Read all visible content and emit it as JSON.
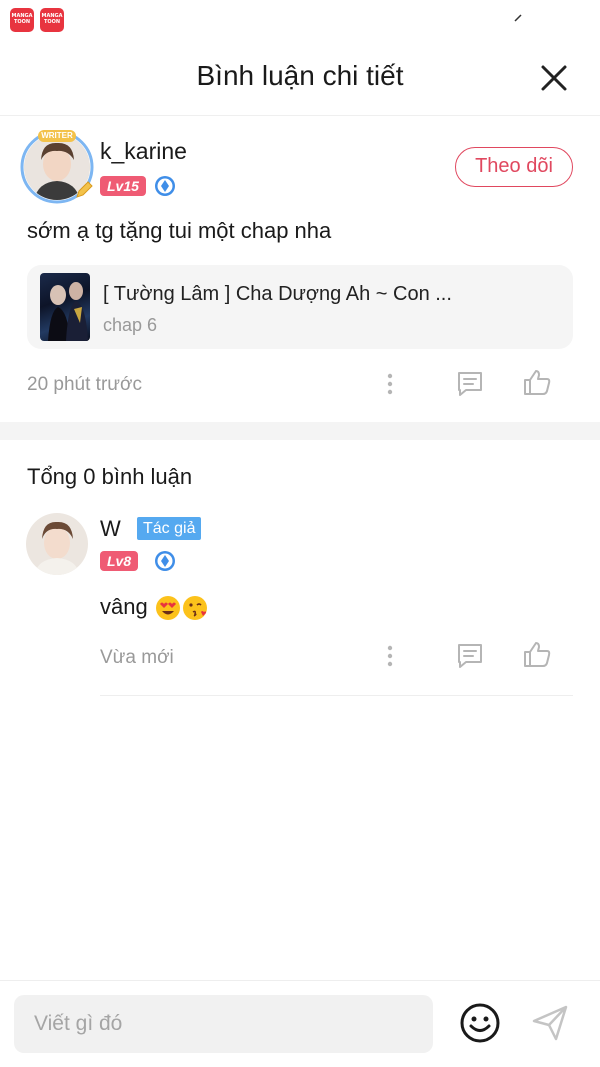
{
  "status_bar": {
    "app_icon_label": "MANGA TOON"
  },
  "header": {
    "title": "Bình luận chi tiết"
  },
  "comment": {
    "writer_tag": "WRITER",
    "username": "k_karine",
    "level": "Lv15",
    "follow_label": "Theo dõi",
    "text": "sớm ạ tg tặng tui một chap nha",
    "work": {
      "title": "[ Tường Lâm ] Cha Dượng Ah ~ Con ...",
      "chapter": "chap 6"
    },
    "time": "20 phút trước"
  },
  "replies": {
    "total_label": "Tổng 0 bình luận",
    "items": [
      {
        "username": "W",
        "role_tag": "Tác giả",
        "level": "Lv8",
        "text": "vâng",
        "time": "Vừa mới"
      }
    ]
  },
  "composer": {
    "placeholder": "Viết gì đó"
  },
  "colors": {
    "accent": "#e0485f",
    "level_badge": "#ef5b74",
    "author_tag": "#55a9f0",
    "muted": "#999999"
  },
  "icons": [
    "close-icon",
    "more-vertical-icon",
    "reply-icon",
    "like-icon",
    "gem-icon",
    "smiley-icon",
    "send-icon"
  ]
}
